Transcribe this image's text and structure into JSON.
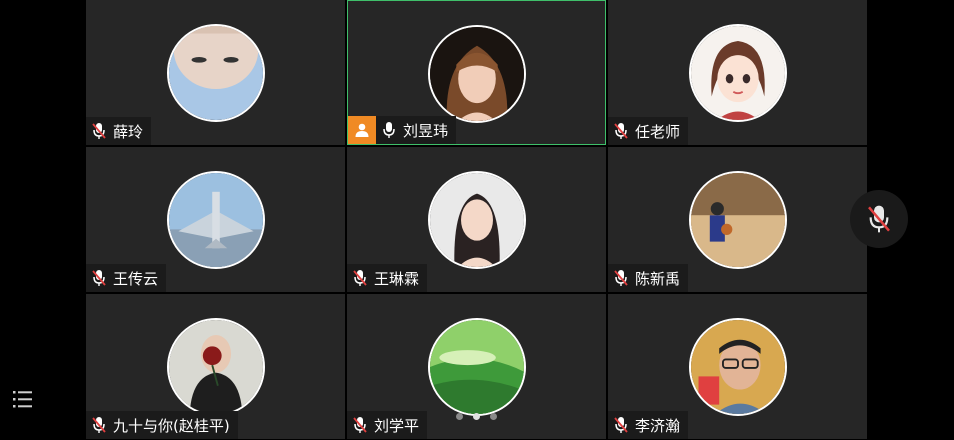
{
  "participants": [
    {
      "name": "薛玲",
      "mic": "muted",
      "avatar": "upside-down-face-photo"
    },
    {
      "name": "刘昱玮",
      "mic": "on",
      "host": true,
      "active_speaker": true,
      "avatar": "woman-portrait-photo"
    },
    {
      "name": "任老师",
      "mic": "muted",
      "avatar": "cartoon-girl-illustration"
    },
    {
      "name": "王传云",
      "mic": "muted",
      "avatar": "fighter-jet-photo"
    },
    {
      "name": "王琳霖",
      "mic": "muted",
      "avatar": "woman-selfie-photo"
    },
    {
      "name": "陈新禹",
      "mic": "muted",
      "avatar": "basketball-court-photo"
    },
    {
      "name": "九十与你(赵桂平)",
      "mic": "muted",
      "avatar": "person-with-rose-photo"
    },
    {
      "name": "刘学平",
      "mic": "muted",
      "avatar": "green-landscape-photo"
    },
    {
      "name": "李济瀚",
      "mic": "muted",
      "avatar": "man-with-glasses-photo"
    }
  ],
  "pager": {
    "pages": 3,
    "current": 2
  },
  "icons": {
    "mic_muted": "mic-muted-icon",
    "mic_on": "mic-icon",
    "host": "host-person-icon",
    "side": "mic-muted-icon",
    "menu": "menu-list-icon"
  },
  "colors": {
    "active_border": "#3fbf6a",
    "host_badge": "#f08a24",
    "muted_slash": "#e04040",
    "tile_bg": "#262626"
  }
}
